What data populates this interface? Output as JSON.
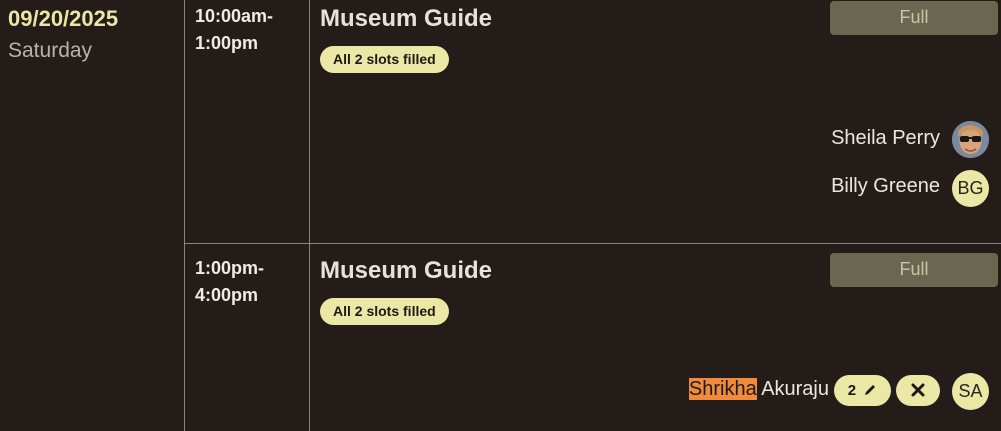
{
  "day": {
    "date": "09/20/2025",
    "weekday": "Saturday"
  },
  "shifts": [
    {
      "time_start": "10:00am-",
      "time_end": "1:00pm",
      "title": "Museum Guide",
      "status_pill": "All 2 slots filled",
      "full_label": "Full",
      "volunteers": [
        {
          "name": "Sheila Perry",
          "avatar": "photo"
        },
        {
          "name": "Billy Greene",
          "initials": "BG"
        }
      ]
    },
    {
      "time_start": "1:00pm-",
      "time_end": "4:00pm",
      "title": "Museum Guide",
      "status_pill": "All 2 slots filled",
      "full_label": "Full",
      "volunteers": [
        {
          "name_highlight": "Shrikha",
          "name_rest": " Akuraju",
          "count": "2",
          "initials": "SA",
          "edit_icon": "pencil-icon",
          "remove_icon": "close-icon"
        }
      ]
    }
  ],
  "colors": {
    "background": "#241c18",
    "accent": "#ebe8a6",
    "date": "#ece6a6",
    "full_button": "#6b6650",
    "highlight": "#f08a3c"
  }
}
